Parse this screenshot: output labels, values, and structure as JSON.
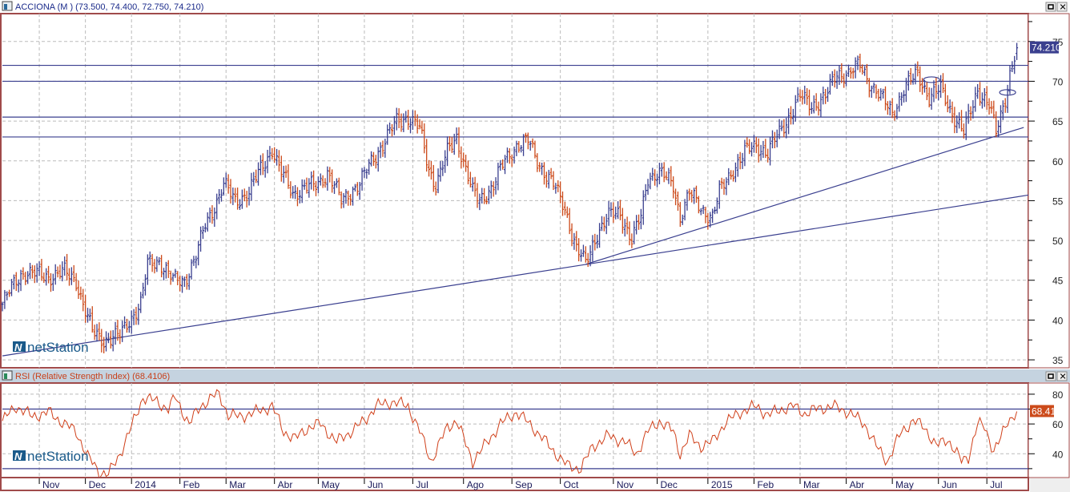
{
  "window": {
    "title": "ACCIONA (M ) (73.500, 74.400, 72.750, 74.210)",
    "rsi_title": "RSI (Relative Strength Index) (68.4106)",
    "logo_text": "netStation",
    "logo_mark": "N",
    "maximize_icon": "maximize-icon",
    "close_icon": "close-icon"
  },
  "colors": {
    "up_bar": "#3a3f8f",
    "down_bar": "#cc4a1a",
    "line": "#3a3f8f",
    "rsi_line": "#d0401a",
    "frame": "#a04a4a",
    "price_tag_bg": "#3a3f8f",
    "rsi_tag_bg": "#cc4a1a",
    "panel_bar_bg": "#c5d3e0"
  },
  "chart_data": [
    {
      "type": "ohlc",
      "title": "ACCIONA (M )",
      "last": {
        "open": 73.5,
        "high": 74.4,
        "low": 72.75,
        "close": 74.21
      },
      "last_label": "74.210",
      "x_unit": "trading day index",
      "xlim": [
        0,
        445
      ],
      "ylim": [
        34,
        78.5
      ],
      "yticks": [
        "35",
        "40",
        "45",
        "50",
        "55",
        "60",
        "65",
        "70",
        "75"
      ],
      "grid": true,
      "approx_close_path": [
        [
          0,
          42
        ],
        [
          6,
          45
        ],
        [
          9,
          46
        ],
        [
          20,
          45.5
        ],
        [
          27,
          46
        ],
        [
          32,
          45
        ],
        [
          35,
          42
        ],
        [
          39,
          38.5
        ],
        [
          44,
          37.5
        ],
        [
          51,
          38
        ],
        [
          55,
          40
        ],
        [
          60,
          42
        ],
        [
          63,
          47
        ],
        [
          68,
          47.5
        ],
        [
          74,
          45
        ],
        [
          79,
          45
        ],
        [
          84,
          48
        ],
        [
          88,
          52
        ],
        [
          93,
          55
        ],
        [
          96,
          57
        ],
        [
          101,
          55
        ],
        [
          107,
          56
        ],
        [
          112,
          59
        ],
        [
          117,
          61.5
        ],
        [
          120,
          59
        ],
        [
          126,
          56
        ],
        [
          131,
          56.5
        ],
        [
          136,
          57
        ],
        [
          141,
          58.5
        ],
        [
          147,
          55
        ],
        [
          150,
          56
        ],
        [
          155,
          57
        ],
        [
          160,
          60
        ],
        [
          166,
          62.5
        ],
        [
          171,
          65
        ],
        [
          176,
          65.5
        ],
        [
          181,
          64
        ],
        [
          185,
          59
        ],
        [
          188,
          57
        ],
        [
          193,
          61
        ],
        [
          197,
          63
        ],
        [
          200,
          60
        ],
        [
          204,
          56
        ],
        [
          207,
          55
        ],
        [
          213,
          57
        ],
        [
          218,
          60
        ],
        [
          223,
          62
        ],
        [
          228,
          62.5
        ],
        [
          232,
          60
        ],
        [
          239,
          57
        ],
        [
          244,
          54
        ],
        [
          249,
          49
        ],
        [
          253,
          47
        ],
        [
          258,
          51
        ],
        [
          263,
          53
        ],
        [
          268,
          53.5
        ],
        [
          273,
          50
        ],
        [
          277,
          53
        ],
        [
          280,
          58
        ],
        [
          285,
          58.5
        ],
        [
          291,
          57
        ],
        [
          294,
          53
        ],
        [
          298,
          56
        ],
        [
          303,
          54
        ],
        [
          308,
          53
        ],
        [
          311,
          56
        ],
        [
          317,
          59
        ],
        [
          322,
          61
        ],
        [
          327,
          62
        ],
        [
          332,
          61
        ],
        [
          338,
          64
        ],
        [
          343,
          66.5
        ],
        [
          346,
          68
        ],
        [
          351,
          67
        ],
        [
          357,
          68
        ],
        [
          362,
          71
        ],
        [
          367,
          71
        ],
        [
          372,
          72
        ],
        [
          376,
          70
        ],
        [
          381,
          68
        ],
        [
          386,
          66
        ],
        [
          391,
          69
        ],
        [
          397,
          71
        ],
        [
          402,
          68
        ],
        [
          407,
          69
        ],
        [
          412,
          66
        ],
        [
          417,
          63.5
        ],
        [
          423,
          69
        ],
        [
          428,
          67
        ],
        [
          431,
          63.5
        ],
        [
          435,
          68
        ],
        [
          437,
          71
        ],
        [
          440,
          74.21
        ]
      ],
      "horizontal_levels": [
        72,
        70,
        65.5,
        63
      ],
      "trendlines": [
        {
          "from": [
            0,
            35.5
          ],
          "to": [
            445,
            55.7
          ]
        },
        {
          "from": [
            253,
            47
          ],
          "to": [
            443,
            64.2
          ]
        }
      ],
      "ellipse_marks": [
        [
          403,
          70.2
        ],
        [
          436,
          68.6
        ]
      ]
    },
    {
      "type": "line",
      "title": "RSI (Relative Strength Index)",
      "last_label": "68.41",
      "xlim": [
        0,
        445
      ],
      "ylim": [
        24,
        87.5
      ],
      "yticks": [
        "40",
        "60",
        "80"
      ],
      "levels": [
        70,
        30
      ],
      "series": [
        [
          0,
          62
        ],
        [
          6,
          72
        ],
        [
          13,
          65
        ],
        [
          20,
          68
        ],
        [
          27,
          60
        ],
        [
          32,
          55
        ],
        [
          37,
          38
        ],
        [
          42,
          28
        ],
        [
          46,
          26
        ],
        [
          51,
          40
        ],
        [
          56,
          58
        ],
        [
          61,
          78
        ],
        [
          67,
          75
        ],
        [
          72,
          70
        ],
        [
          75,
          78
        ],
        [
          81,
          60
        ],
        [
          86,
          72
        ],
        [
          91,
          78
        ],
        [
          94,
          80
        ],
        [
          98,
          66
        ],
        [
          103,
          65
        ],
        [
          110,
          68
        ],
        [
          117,
          72
        ],
        [
          122,
          55
        ],
        [
          127,
          50
        ],
        [
          133,
          58
        ],
        [
          138,
          60
        ],
        [
          145,
          48
        ],
        [
          152,
          56
        ],
        [
          157,
          62
        ],
        [
          162,
          72
        ],
        [
          169,
          75
        ],
        [
          176,
          72
        ],
        [
          181,
          55
        ],
        [
          186,
          35
        ],
        [
          193,
          58
        ],
        [
          197,
          62
        ],
        [
          204,
          35
        ],
        [
          209,
          45
        ],
        [
          216,
          60
        ],
        [
          223,
          68
        ],
        [
          230,
          58
        ],
        [
          239,
          42
        ],
        [
          245,
          32
        ],
        [
          251,
          30
        ],
        [
          256,
          45
        ],
        [
          263,
          52
        ],
        [
          270,
          48
        ],
        [
          275,
          40
        ],
        [
          280,
          55
        ],
        [
          285,
          62
        ],
        [
          291,
          55
        ],
        [
          294,
          40
        ],
        [
          298,
          52
        ],
        [
          303,
          45
        ],
        [
          308,
          48
        ],
        [
          313,
          60
        ],
        [
          320,
          68
        ],
        [
          327,
          72
        ],
        [
          332,
          66
        ],
        [
          338,
          70
        ],
        [
          343,
          72
        ],
        [
          348,
          67
        ],
        [
          353,
          70
        ],
        [
          360,
          72
        ],
        [
          367,
          68
        ],
        [
          374,
          60
        ],
        [
          379,
          45
        ],
        [
          384,
          35
        ],
        [
          390,
          55
        ],
        [
          395,
          62
        ],
        [
          400,
          58
        ],
        [
          405,
          45
        ],
        [
          410,
          50
        ],
        [
          416,
          35
        ],
        [
          419,
          38
        ],
        [
          423,
          60
        ],
        [
          426,
          58
        ],
        [
          430,
          42
        ],
        [
          433,
          50
        ],
        [
          436,
          62
        ],
        [
          440,
          68.41
        ]
      ]
    }
  ],
  "x_axis": {
    "ticks": [
      {
        "day": 16,
        "label": "Nov"
      },
      {
        "day": 36,
        "label": "Dec"
      },
      {
        "day": 56,
        "label": "2014"
      },
      {
        "day": 77,
        "label": "Feb"
      },
      {
        "day": 97,
        "label": "Mar"
      },
      {
        "day": 118,
        "label": "Abr"
      },
      {
        "day": 137,
        "label": "May"
      },
      {
        "day": 157,
        "label": "Jun"
      },
      {
        "day": 178,
        "label": "Jul"
      },
      {
        "day": 200,
        "label": "Ago"
      },
      {
        "day": 221,
        "label": "Sep"
      },
      {
        "day": 242,
        "label": "Oct"
      },
      {
        "day": 265,
        "label": "Nov"
      },
      {
        "day": 284,
        "label": "Dec"
      },
      {
        "day": 306,
        "label": "2015"
      },
      {
        "day": 326,
        "label": "Feb"
      },
      {
        "day": 346,
        "label": "Mar"
      },
      {
        "day": 366,
        "label": "Abr"
      },
      {
        "day": 386,
        "label": "May"
      },
      {
        "day": 406,
        "label": "Jun"
      },
      {
        "day": 427,
        "label": "Jul"
      }
    ]
  }
}
